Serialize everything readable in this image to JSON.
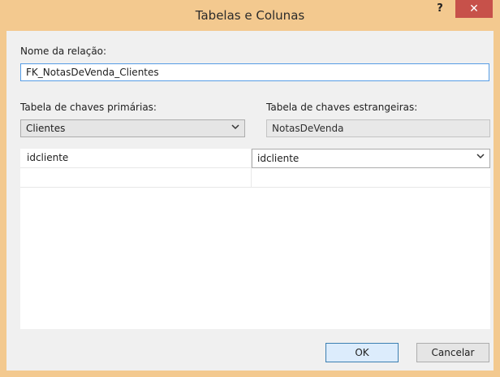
{
  "window": {
    "title": "Tabelas e Colunas",
    "help_label": "?",
    "close_label": "✕"
  },
  "form": {
    "relation_label": "Nome da relação:",
    "relation_value": "FK_NotasDeVenda_Clientes",
    "primary_label": "Tabela de chaves primárias:",
    "primary_value": "Clientes",
    "foreign_label": "Tabela de chaves estrangeiras:",
    "foreign_value": "NotasDeVenda"
  },
  "grid": {
    "rows": [
      {
        "primary_column": "idcliente",
        "foreign_column": "idcliente"
      },
      {
        "primary_column": "",
        "foreign_column": ""
      }
    ]
  },
  "buttons": {
    "ok": "OK",
    "cancel": "Cancelar"
  },
  "colors": {
    "frame": "#f3c98f",
    "close": "#c7514a",
    "accent_border": "#569de5"
  },
  "icons": {
    "dropdown": "chevron-down-icon",
    "help": "help-icon",
    "close": "close-icon"
  }
}
